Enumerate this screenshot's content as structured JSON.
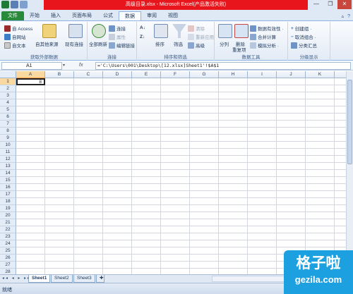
{
  "window": {
    "title": "高级目录.xlsx - Microsoft Excel(产品激活失败)",
    "buttons": {
      "minimize": "—",
      "restore": "❐",
      "close": "✕"
    }
  },
  "ribbon_tabs": [
    "文件",
    "开始",
    "插入",
    "页面布局",
    "公式",
    "数据",
    "审阅",
    "视图"
  ],
  "active_tab": "数据",
  "groups": {
    "external": {
      "label": "获取外部数据",
      "access": "自 Access",
      "web": "自网站",
      "text": "自文本",
      "other": "自其他来源",
      "existing": "现有连接"
    },
    "connections": {
      "label": "连接",
      "refresh_all": "全部刷新",
      "connections": "连接",
      "properties": "属性",
      "edit_links": "编辑链接"
    },
    "sort_filter": {
      "label": "排序和筛选",
      "sort": "排序",
      "filter": "筛选",
      "clear": "清除",
      "reapply": "重新应用",
      "advanced": "高级"
    },
    "data_tools": {
      "label": "数据工具",
      "split": "分列",
      "remove_dup_1": "删除",
      "remove_dup_2": "重复项",
      "validation": "数据有效性 ·",
      "consolidate": "合并计算",
      "whatif": "模拟分析 ·"
    },
    "outline": {
      "label": "分级显示",
      "group": "创建组 ·",
      "ungroup": "取消组合 ·",
      "subtotal": "分类汇总"
    }
  },
  "formula_bar": {
    "name_box": "A1",
    "fx": "fx",
    "formula": "='C:\\Users\\001\\Desktop\\[12.xlsx]Sheet1'!$A$1"
  },
  "columns": [
    "A",
    "B",
    "C",
    "D",
    "E",
    "F",
    "G",
    "H",
    "I",
    "J",
    "K",
    "L"
  ],
  "rows": [
    "1",
    "2",
    "3",
    "4",
    "5",
    "6",
    "7",
    "8",
    "9",
    "10",
    "11",
    "12",
    "13",
    "14",
    "15",
    "16",
    "17",
    "18",
    "19",
    "20",
    "21",
    "22",
    "23",
    "24",
    "25",
    "26",
    "27",
    "28"
  ],
  "active_cell_value": "8",
  "sheet_nav": "◂◂ ◂ ▸ ▸▸",
  "sheets": [
    "Sheet1",
    "Sheet2",
    "Sheet3"
  ],
  "status": "就绪",
  "watermark": {
    "cn": "格子啦",
    "url": "gezila.com"
  }
}
